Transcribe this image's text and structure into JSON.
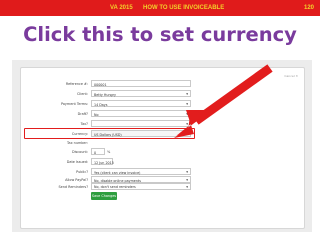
{
  "topbar": {
    "left": "VA 2015",
    "center": "HOW TO USE INVOICEABLE",
    "page": "120"
  },
  "heading": "Click this to set currency",
  "form": {
    "cancel": "Cancel ✕",
    "rows": [
      {
        "label": "Reference #:",
        "value": "000001",
        "caret": ""
      },
      {
        "label": "Client:",
        "value": "Betty Hungry",
        "caret": "▾"
      },
      {
        "label": "Payment Terms:",
        "value": "14 Days",
        "caret": "▾"
      },
      {
        "label": "Draft?",
        "value": "No",
        "caret": "▾"
      },
      {
        "label": "Tax?",
        "value": "",
        "caret": "▾"
      },
      {
        "label": "Currency:",
        "value": "US Dollars (USD)",
        "caret": "▾"
      },
      {
        "label": "Tax number:",
        "value": "",
        "caret": ""
      },
      {
        "label": "Discount:",
        "value": "0",
        "caret": ""
      },
      {
        "label": "Date Issued:",
        "value": "12 Jun 2015",
        "caret": ""
      },
      {
        "label": "Public?",
        "value": "Yes (client can view invoice)",
        "caret": "▾"
      },
      {
        "label": "Allow PayPal?",
        "value": "No, disable online payments",
        "caret": "▾"
      },
      {
        "label": "Send Reminders?",
        "value": "No, don't send reminders",
        "caret": "▾"
      }
    ],
    "discount_unit": "%",
    "save_label": "Save Changes"
  },
  "colors": {
    "topbar_bg": "#e01b1b",
    "topbar_text": "#f2d12a",
    "heading": "#7a3b9d",
    "highlight": "#e21d1d",
    "save": "#2e9e3f"
  }
}
